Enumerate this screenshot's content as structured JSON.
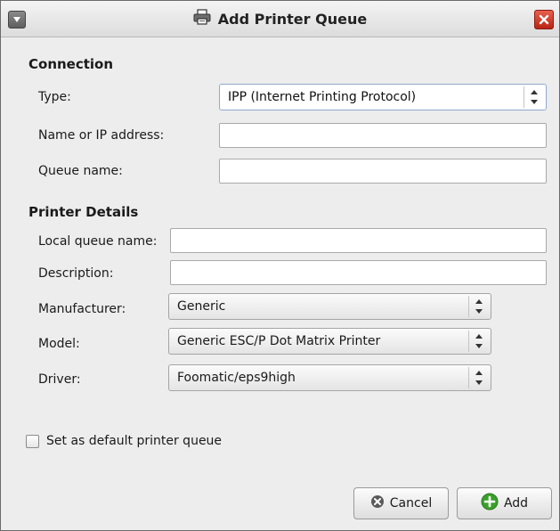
{
  "window": {
    "title": "Add Printer Queue"
  },
  "connection": {
    "section_title": "Connection",
    "type_label": "Type:",
    "type_value": "IPP (Internet Printing Protocol)",
    "name_label": "Name or IP address:",
    "name_value": "",
    "queue_label": "Queue name:",
    "queue_value": ""
  },
  "details": {
    "section_title": "Printer Details",
    "local_label": "Local queue name:",
    "local_value": "",
    "desc_label": "Description:",
    "desc_value": "",
    "manufacturer_label": "Manufacturer:",
    "manufacturer_value": "Generic",
    "model_label": "Model:",
    "model_value": "Generic ESC/P Dot Matrix Printer",
    "driver_label": "Driver:",
    "driver_value": "Foomatic/eps9high"
  },
  "default_checkbox": {
    "label": "Set as default printer queue",
    "checked": false
  },
  "buttons": {
    "cancel": "Cancel",
    "add": "Add"
  },
  "icons": {
    "window_menu": "chevron-down-icon",
    "title": "printer-icon",
    "close": "close-icon",
    "cancel": "cancel-icon",
    "add": "plus-icon"
  },
  "colors": {
    "close_button": "#c8321f",
    "add_icon": "#3aa02b",
    "cancel_icon": "#555555"
  }
}
